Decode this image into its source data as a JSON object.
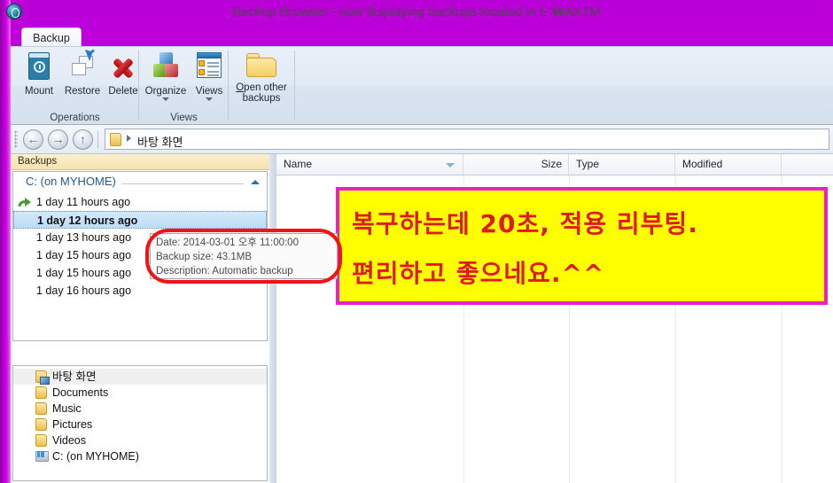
{
  "window": {
    "title": "Backup Browser - now displaying backups located in E:₩AXTM",
    "app_icon": "backup-app-icon",
    "frame_color": "#cc00e8"
  },
  "ribbon": {
    "tab_label": "Backup",
    "groups": [
      {
        "label": "Operations",
        "buttons": [
          {
            "label": "Mount",
            "icon": "disk-clock-icon"
          },
          {
            "label": "Restore",
            "icon": "restore-window-arrow-icon"
          },
          {
            "label": "Delete",
            "icon": "red-x-icon"
          }
        ]
      },
      {
        "label": "Views",
        "buttons": [
          {
            "label": "Organize",
            "icon": "colored-cubes-icon",
            "has_dropdown": true
          },
          {
            "label": "Views",
            "icon": "list-window-icon",
            "has_dropdown": true
          }
        ]
      },
      {
        "label": "",
        "buttons": [
          {
            "label_line1": "Open other",
            "label_line2": "backups",
            "accel": "O",
            "icon": "open-folder-icon"
          }
        ]
      }
    ]
  },
  "navbar": {
    "back_icon": "back-arrow-icon",
    "forward_icon": "forward-arrow-icon",
    "up_icon": "up-arrow-icon",
    "breadcrumb_icon": "folder-icon",
    "breadcrumb_text": "바탕 화면"
  },
  "left_pane": {
    "header": "Backups",
    "group": {
      "label": "C: (on MYHOME)",
      "collapsed": false
    },
    "items": [
      {
        "label": "1 day 11 hours ago",
        "icon": "green-restore-arrow-icon",
        "selected": false
      },
      {
        "label": "1 day 12 hours ago",
        "icon": "",
        "selected": true
      },
      {
        "label": "1 day 13 hours ago",
        "icon": "",
        "selected": false
      },
      {
        "label": "1 day 15 hours ago",
        "icon": "",
        "selected": false
      },
      {
        "label": "1 day 15 hours ago",
        "icon": "",
        "selected": false
      },
      {
        "label": "1 day 16 hours ago",
        "icon": "",
        "selected": false
      }
    ]
  },
  "folder_tree": {
    "items": [
      {
        "label": "바탕 화면",
        "icon": "desktop-folder-icon",
        "selected": true
      },
      {
        "label": "Documents",
        "icon": "folder-icon",
        "selected": false
      },
      {
        "label": "Music",
        "icon": "folder-icon",
        "selected": false
      },
      {
        "label": "Pictures",
        "icon": "folder-icon",
        "selected": false
      },
      {
        "label": "Videos",
        "icon": "folder-icon",
        "selected": false
      },
      {
        "label": "C: (on MYHOME)",
        "icon": "drive-icon",
        "selected": false
      }
    ]
  },
  "file_list": {
    "columns": [
      {
        "label": "Name",
        "sorted": true
      },
      {
        "label": "Size",
        "sorted": false
      },
      {
        "label": "Type",
        "sorted": false
      },
      {
        "label": "Modified",
        "sorted": false
      }
    ],
    "rows": []
  },
  "tooltip": {
    "date_line": "Date: 2014-03-01 오후 11:00:00",
    "size_line": "Backup size: 43.1MB",
    "desc_line": "Description: Automatic backup",
    "highlight_color": "#f21414"
  },
  "annotation": {
    "line1": "복구하는데 20초, 적용 리부팅.",
    "line2": "편리하고 좋으네요.^^",
    "background": "#ffff00",
    "border_color": "#e822c8",
    "text_color": "#e01a1a"
  }
}
